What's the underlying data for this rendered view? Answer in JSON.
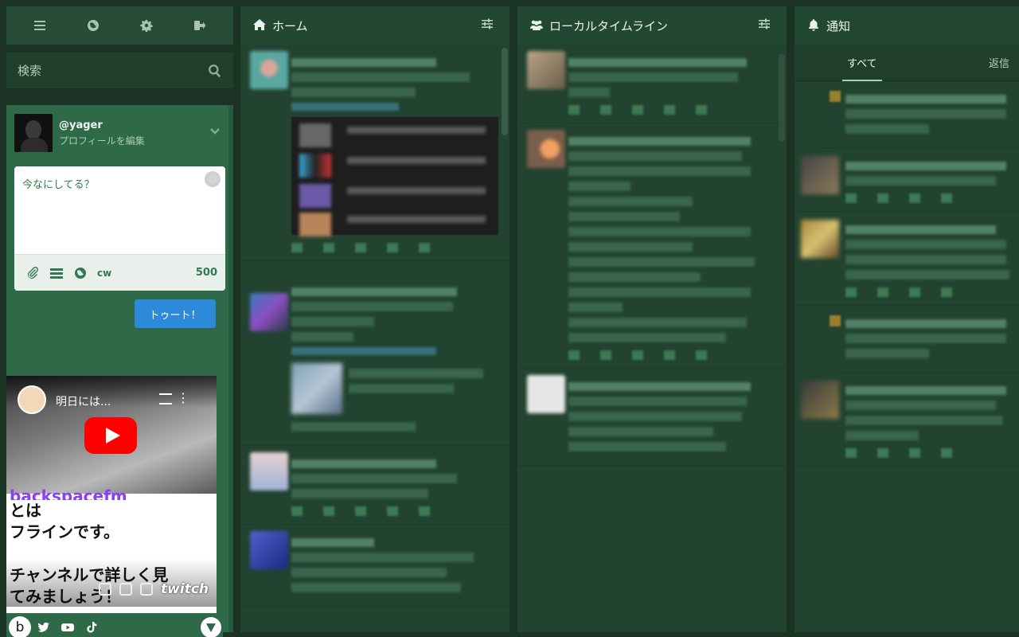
{
  "drawer": {
    "nav": [
      {
        "name": "menu-icon"
      },
      {
        "name": "globe-icon"
      },
      {
        "name": "gear-icon"
      },
      {
        "name": "logout-icon"
      }
    ],
    "search_placeholder": "検索",
    "account": {
      "handle": "@yager",
      "edit_profile": "プロフィールを編集"
    },
    "compose": {
      "placeholder": "今なにしてる？",
      "cw_label": "cw",
      "char_count": "500",
      "toot_button": "トゥート！"
    },
    "video": {
      "title": "明日には...",
      "channel": "backspacefm",
      "offline_text": "とは\nフラインです。\n\nチャンネルで詳しく見\nてみましょう！",
      "twitch_label": "twitch"
    },
    "social": [
      "b",
      "twitter-icon",
      "youtube-icon",
      "tiktok-icon"
    ]
  },
  "columns": {
    "home": {
      "title": "ホーム",
      "icon": "home-icon"
    },
    "local": {
      "title": "ローカルタイムライン",
      "icon": "users-icon"
    },
    "notifications": {
      "title": "通知",
      "icon": "bell-icon",
      "tabs": [
        "すべて",
        "返信"
      ]
    }
  },
  "colors": {
    "background": "#1a3325",
    "column": "#21432f",
    "drawer_accent": "#2f6a48",
    "toot_button": "#2d8ad8",
    "youtube_red": "#ff0000"
  }
}
